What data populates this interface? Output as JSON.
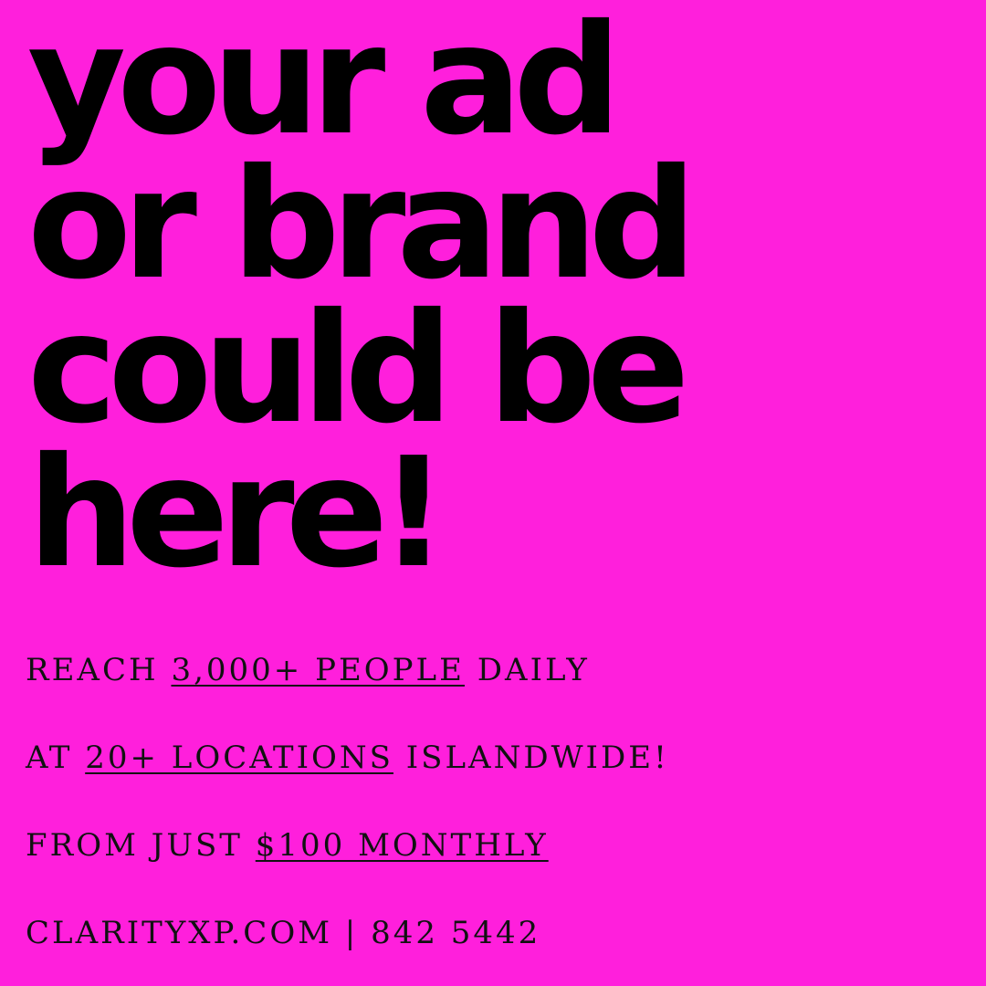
{
  "colors": {
    "background": "#ff1fdc",
    "text": "#000000"
  },
  "headline": {
    "line1": "your ad",
    "line2": "or brand",
    "line3": "could be",
    "line4": "here!"
  },
  "details": {
    "reach": {
      "prefix": "REACH",
      "highlight": "3,000+ PEOPLE",
      "suffix": "DAILY"
    },
    "locations": {
      "prefix": "AT",
      "highlight": "20+ LOCATIONS",
      "suffix": "ISLANDWIDE!"
    },
    "price": {
      "prefix": "FROM JUST",
      "highlight": "$100 MONTHLY"
    },
    "contact": {
      "text": "CLARITYXP.COM | 842 5442"
    }
  }
}
